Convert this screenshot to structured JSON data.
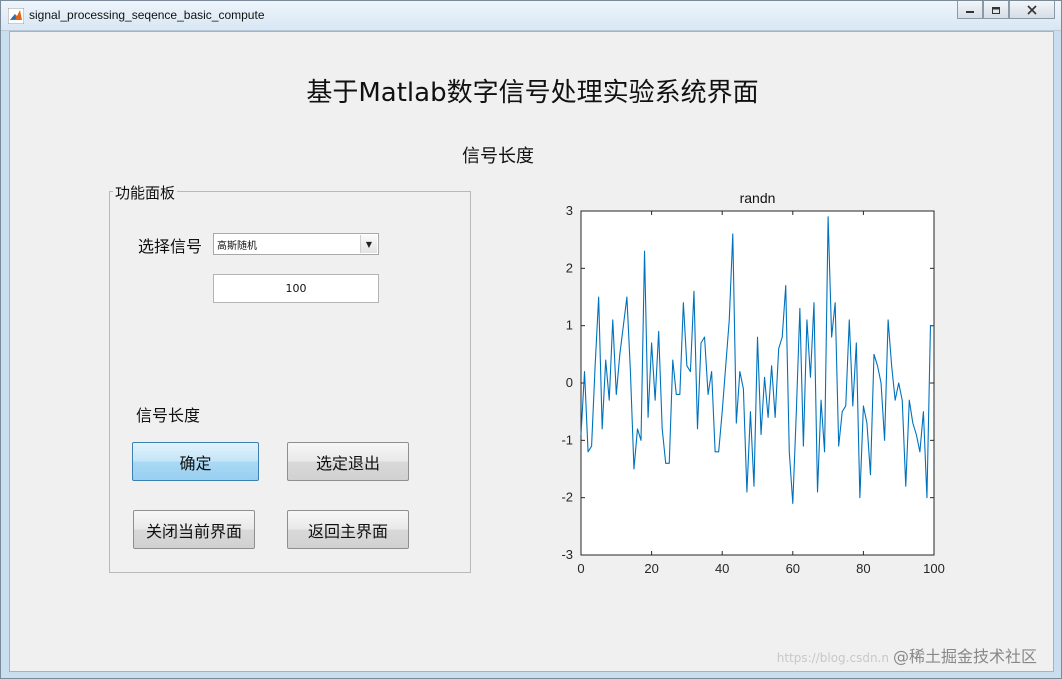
{
  "window": {
    "title": "signal_processing_seqence_basic_compute",
    "icon": "matlab-icon",
    "controls": [
      "minimize",
      "restore",
      "close"
    ]
  },
  "header": {
    "title": "基于Matlab数字信号处理实验系统界面",
    "subtitle": "信号长度"
  },
  "panel": {
    "legend": "功能面板",
    "select_label": "选择信号",
    "select_value": "高斯随机",
    "length_value": "100",
    "length_label": "信号长度",
    "buttons": {
      "confirm": "确定",
      "select_exit": "选定退出",
      "close_current": "关闭当前界面",
      "back_main": "返回主界面"
    }
  },
  "chart_data": {
    "type": "line",
    "title": "randn",
    "xlabel": "",
    "ylabel": "",
    "xlim": [
      0,
      100
    ],
    "ylim": [
      -3,
      3
    ],
    "xticks": [
      0,
      20,
      40,
      60,
      80,
      100
    ],
    "yticks": [
      3,
      2,
      1,
      0,
      -1,
      -2,
      -3
    ],
    "color": "#0072bd",
    "grid": false,
    "series": [
      {
        "values": [
          -0.9,
          0.2,
          -1.2,
          -1.1,
          0.3,
          1.5,
          -0.8,
          0.4,
          -0.3,
          1.1,
          -0.2,
          0.5,
          1.0,
          1.5,
          0.2,
          -1.5,
          -0.8,
          -1.0,
          2.3,
          -0.6,
          0.7,
          -0.3,
          0.9,
          -0.8,
          -1.4,
          -1.4,
          0.4,
          -0.2,
          -0.2,
          1.4,
          0.3,
          0.2,
          1.6,
          -0.8,
          0.7,
          0.8,
          -0.2,
          0.2,
          -1.2,
          -1.2,
          -0.5,
          0.3,
          1.1,
          2.6,
          -0.7,
          0.2,
          -0.1,
          -1.9,
          -0.5,
          -1.8,
          0.8,
          -0.9,
          0.1,
          -0.6,
          0.3,
          -0.6,
          0.6,
          0.8,
          1.7,
          -1.2,
          -2.1,
          -0.5,
          1.3,
          -1.1,
          1.1,
          0.1,
          1.4,
          -1.9,
          -0.3,
          -1.2,
          2.9,
          0.8,
          1.4,
          -1.1,
          -0.5,
          -0.4,
          1.1,
          -0.4,
          0.7,
          -2.0,
          -0.4,
          -0.7,
          -1.6,
          0.5,
          0.3,
          0.0,
          -1.0,
          1.1,
          0.3,
          -0.3,
          0.0,
          -0.3,
          -1.8,
          -0.3,
          -0.7,
          -0.9,
          -1.2,
          -0.5,
          -2.0,
          1.0,
          1.0
        ]
      }
    ]
  },
  "watermark": {
    "faint": "https://blog.csdn.n",
    "text": "@稀土掘金技术社区"
  }
}
